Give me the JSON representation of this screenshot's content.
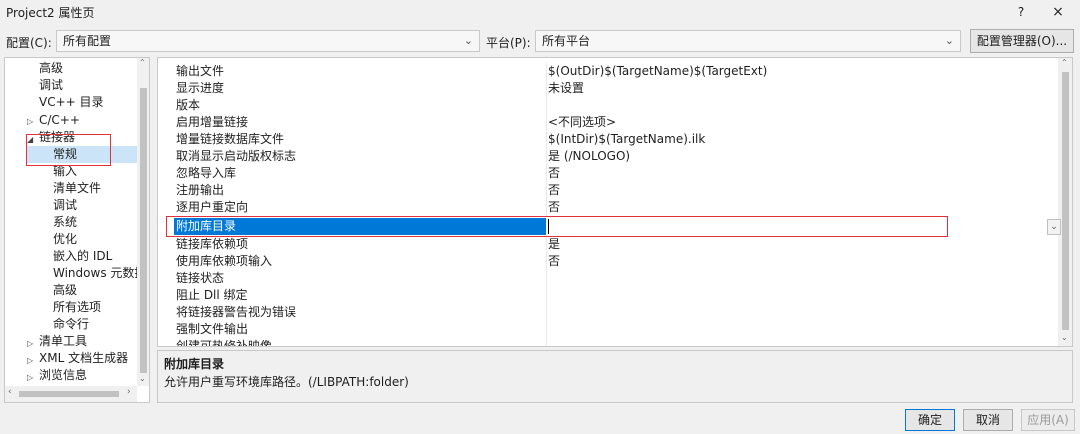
{
  "window": {
    "title": "Project2 属性页",
    "help_label": "?",
    "close_label": "×"
  },
  "config_row": {
    "config_label": "配置(C):",
    "config_value": "所有配置",
    "platform_label": "平台(P):",
    "platform_value": "所有平台",
    "manager_button": "配置管理器(O)..."
  },
  "tree": {
    "items": [
      {
        "label": "高级"
      },
      {
        "label": "调试"
      },
      {
        "label": "VC++ 目录"
      },
      {
        "label": "C/C++"
      },
      {
        "label": "链接器"
      },
      {
        "label": "常规"
      },
      {
        "label": "输入"
      },
      {
        "label": "清单文件"
      },
      {
        "label": "调试"
      },
      {
        "label": "系统"
      },
      {
        "label": "优化"
      },
      {
        "label": "嵌入的 IDL"
      },
      {
        "label": "Windows 元数据"
      },
      {
        "label": "高级"
      },
      {
        "label": "所有选项"
      },
      {
        "label": "命令行"
      },
      {
        "label": "清单工具"
      },
      {
        "label": "XML 文档生成器"
      },
      {
        "label": "浏览信息"
      }
    ],
    "selected": "常规"
  },
  "grid": {
    "rows": [
      {
        "name": "输出文件",
        "value": "$(OutDir)$(TargetName)$(TargetExt)"
      },
      {
        "name": "显示进度",
        "value": "未设置"
      },
      {
        "name": "版本",
        "value": ""
      },
      {
        "name": "启用增量链接",
        "value": "<不同选项>"
      },
      {
        "name": "增量链接数据库文件",
        "value": "$(IntDir)$(TargetName).ilk"
      },
      {
        "name": "取消显示启动版权标志",
        "value": "是 (/NOLOGO)"
      },
      {
        "name": "忽略导入库",
        "value": "否"
      },
      {
        "name": "注册输出",
        "value": "否"
      },
      {
        "name": "逐用户重定向",
        "value": "否"
      },
      {
        "name": "附加库目录",
        "value": ""
      },
      {
        "name": "链接库依赖项",
        "value": "是"
      },
      {
        "name": "使用库依赖项输入",
        "value": "否"
      },
      {
        "name": "链接状态",
        "value": ""
      },
      {
        "name": "阻止 Dll 绑定",
        "value": ""
      },
      {
        "name": "将链接器警告视为错误",
        "value": ""
      },
      {
        "name": "强制文件输出",
        "value": ""
      },
      {
        "name": "创建可热修补映像",
        "value": ""
      }
    ],
    "selected": "附加库目录"
  },
  "description": {
    "title": "附加库目录",
    "text": "允许用户重写环境库路径。(/LIBPATH:folder)"
  },
  "buttons": {
    "ok": "确定",
    "cancel": "取消",
    "apply": "应用(A)"
  },
  "colors": {
    "selection_blue": "#0078d7",
    "tree_selection": "#cce4f7",
    "highlight_red": "#e0303a"
  }
}
